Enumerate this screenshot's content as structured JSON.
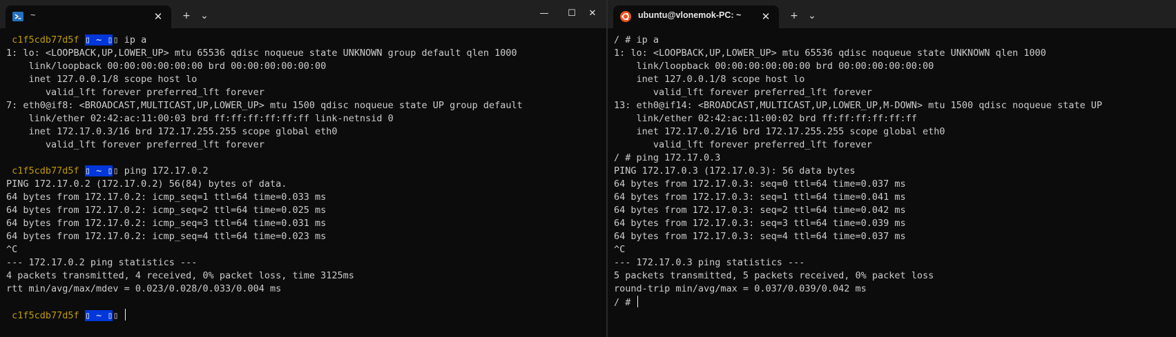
{
  "left_window": {
    "tab": {
      "title": "~",
      "icon": "powershell-icon"
    },
    "new_tab_label": "+",
    "dropdown_label": "⌄",
    "controls": {
      "minimize": "—",
      "maximize": "☐",
      "close": "✕"
    },
    "lines": [
      {
        "host": "c1f5cdb77d5f",
        "seg": "▯ ~ ▯",
        "tail": "▯",
        "cmd": " ip a"
      },
      {
        "text": "1: lo: <LOOPBACK,UP,LOWER_UP> mtu 65536 qdisc noqueue state UNKNOWN group default qlen 1000"
      },
      {
        "text": "    link/loopback 00:00:00:00:00:00 brd 00:00:00:00:00:00"
      },
      {
        "text": "    inet 127.0.0.1/8 scope host lo"
      },
      {
        "text": "       valid_lft forever preferred_lft forever"
      },
      {
        "text": "7: eth0@if8: <BROADCAST,MULTICAST,UP,LOWER_UP> mtu 1500 qdisc noqueue state UP group default"
      },
      {
        "text": "    link/ether 02:42:ac:11:00:03 brd ff:ff:ff:ff:ff:ff link-netnsid 0"
      },
      {
        "text": "    inet 172.17.0.3/16 brd 172.17.255.255 scope global eth0"
      },
      {
        "text": "       valid_lft forever preferred_lft forever"
      },
      {
        "text": ""
      },
      {
        "host": "c1f5cdb77d5f",
        "seg": "▯ ~ ▯",
        "tail": "▯",
        "cmd": " ping 172.17.0.2"
      },
      {
        "text": "PING 172.17.0.2 (172.17.0.2) 56(84) bytes of data."
      },
      {
        "text": "64 bytes from 172.17.0.2: icmp_seq=1 ttl=64 time=0.033 ms"
      },
      {
        "text": "64 bytes from 172.17.0.2: icmp_seq=2 ttl=64 time=0.025 ms"
      },
      {
        "text": "64 bytes from 172.17.0.2: icmp_seq=3 ttl=64 time=0.031 ms"
      },
      {
        "text": "64 bytes from 172.17.0.2: icmp_seq=4 ttl=64 time=0.023 ms"
      },
      {
        "text": "^C"
      },
      {
        "text": "--- 172.17.0.2 ping statistics ---"
      },
      {
        "text": "4 packets transmitted, 4 received, 0% packet loss, time 3125ms"
      },
      {
        "text": "rtt min/avg/max/mdev = 0.023/0.028/0.033/0.004 ms"
      },
      {
        "text": ""
      },
      {
        "host": "c1f5cdb77d5f",
        "seg": "▯ ~ ▯",
        "tail": "▯",
        "cmd": " ",
        "cursor": true
      }
    ]
  },
  "right_window": {
    "tab": {
      "title": "ubuntu@vlonemok-PC: ~",
      "icon": "ubuntu-icon"
    },
    "new_tab_label": "+",
    "dropdown_label": "⌄",
    "lines": [
      {
        "text": "/ # ip a"
      },
      {
        "text": "1: lo: <LOOPBACK,UP,LOWER_UP> mtu 65536 qdisc noqueue state UNKNOWN qlen 1000"
      },
      {
        "text": "    link/loopback 00:00:00:00:00:00 brd 00:00:00:00:00:00"
      },
      {
        "text": "    inet 127.0.0.1/8 scope host lo"
      },
      {
        "text": "       valid_lft forever preferred_lft forever"
      },
      {
        "text": "13: eth0@if14: <BROADCAST,MULTICAST,UP,LOWER_UP,M-DOWN> mtu 1500 qdisc noqueue state UP"
      },
      {
        "text": "    link/ether 02:42:ac:11:00:02 brd ff:ff:ff:ff:ff:ff"
      },
      {
        "text": "    inet 172.17.0.2/16 brd 172.17.255.255 scope global eth0"
      },
      {
        "text": "       valid_lft forever preferred_lft forever"
      },
      {
        "text": "/ # ping 172.17.0.3"
      },
      {
        "text": "PING 172.17.0.3 (172.17.0.3): 56 data bytes"
      },
      {
        "text": "64 bytes from 172.17.0.3: seq=0 ttl=64 time=0.037 ms"
      },
      {
        "text": "64 bytes from 172.17.0.3: seq=1 ttl=64 time=0.041 ms"
      },
      {
        "text": "64 bytes from 172.17.0.3: seq=2 ttl=64 time=0.042 ms"
      },
      {
        "text": "64 bytes from 172.17.0.3: seq=3 ttl=64 time=0.039 ms"
      },
      {
        "text": "64 bytes from 172.17.0.3: seq=4 ttl=64 time=0.037 ms"
      },
      {
        "text": "^C"
      },
      {
        "text": "--- 172.17.0.3 ping statistics ---"
      },
      {
        "text": "5 packets transmitted, 5 packets received, 0% packet loss"
      },
      {
        "text": "round-trip min/avg/max = 0.037/0.039/0.042 ms"
      },
      {
        "text": "/ # ",
        "cursor": true
      }
    ]
  },
  "colors": {
    "background": "#0c0c0c",
    "tabbar": "#202020",
    "foreground": "#cccccc",
    "prompt_host": "#c19c00",
    "prompt_segment_bg": "#0037da",
    "ubuntu_orange": "#e95420",
    "powershell_blue": "#2671be"
  }
}
